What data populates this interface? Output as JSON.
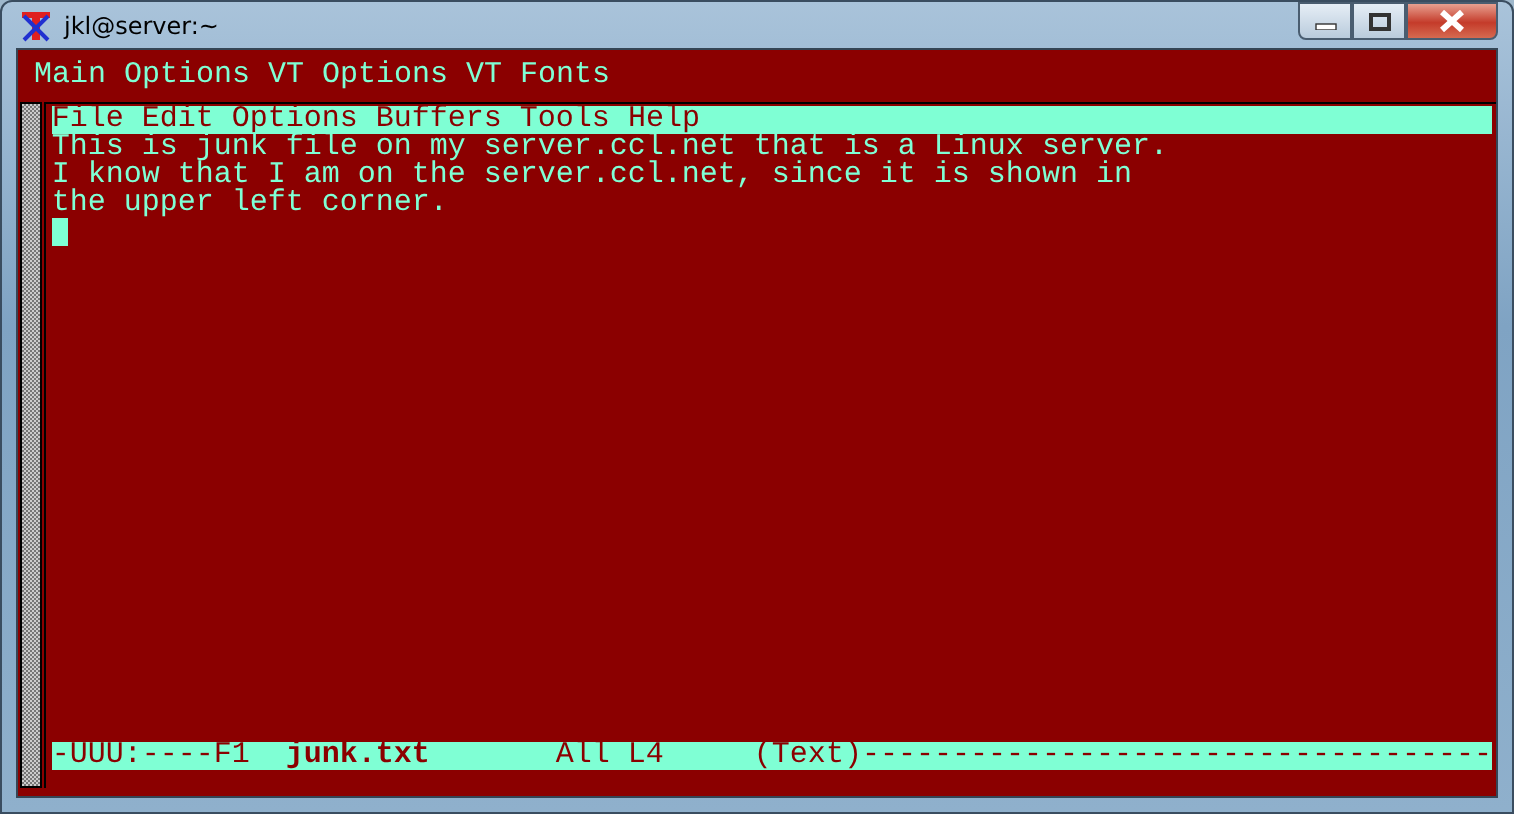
{
  "window": {
    "title": "jkl@server:~"
  },
  "app_menu": [
    "Main Options",
    "VT Options",
    "VT Fonts"
  ],
  "editor_menu": [
    "File",
    "Edit",
    "Options",
    "Buffers",
    "Tools",
    "Help"
  ],
  "lines": [
    "This is junk file on my server.ccl.net that is a Linux server.",
    "I know that I am on the server.ccl.net, since it is shown in",
    "the upper left corner."
  ],
  "mode_line": "-UUU:----F1  **junk.txt**       All L4     (Text)-----------------------------------"
}
